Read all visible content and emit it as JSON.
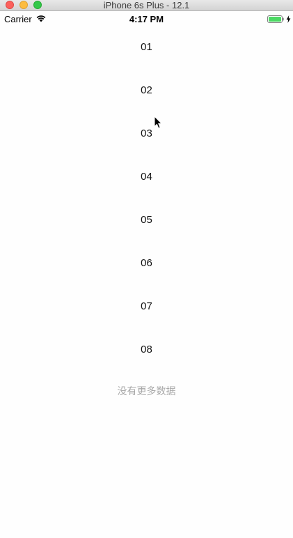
{
  "window": {
    "title": "iPhone 6s Plus - 12.1"
  },
  "status_bar": {
    "carrier": "Carrier",
    "time": "4:17 PM",
    "wifi_icon": "wifi-icon",
    "battery_icon": "battery-icon",
    "charging_icon": "bolt-icon",
    "battery_color": "#4cd964"
  },
  "list": {
    "rows": [
      {
        "label": "01"
      },
      {
        "label": "02"
      },
      {
        "label": "03"
      },
      {
        "label": "04"
      },
      {
        "label": "05"
      },
      {
        "label": "06"
      },
      {
        "label": "07"
      },
      {
        "label": "08"
      }
    ],
    "footer": "没有更多数据"
  }
}
